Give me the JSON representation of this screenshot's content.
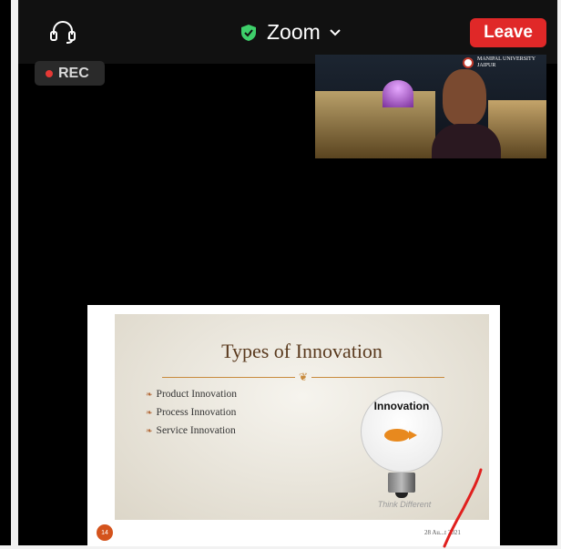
{
  "topbar": {
    "title": "Zoom",
    "leave_label": "Leave",
    "headset_icon": "headset-icon",
    "shield_icon": "shield-check-icon",
    "chevron_icon": "chevron-down-icon"
  },
  "recording": {
    "label": "REC"
  },
  "video": {
    "logo_line1": "MANIPAL UNIVERSITY",
    "logo_line2": "JAIPUR"
  },
  "slide": {
    "title": "Types of Innovation",
    "bullets": [
      "Product Innovation",
      "Process Innovation",
      "Service Innovation"
    ],
    "bulb_label": "Innovation",
    "tagline": "Think Different",
    "page_number": "14",
    "date": "28 Au...t 2021"
  },
  "colors": {
    "leave_button": "#e02828",
    "shield_green": "#3ecf6a",
    "rec_dot": "#e53935",
    "annotation": "#e0201e"
  }
}
